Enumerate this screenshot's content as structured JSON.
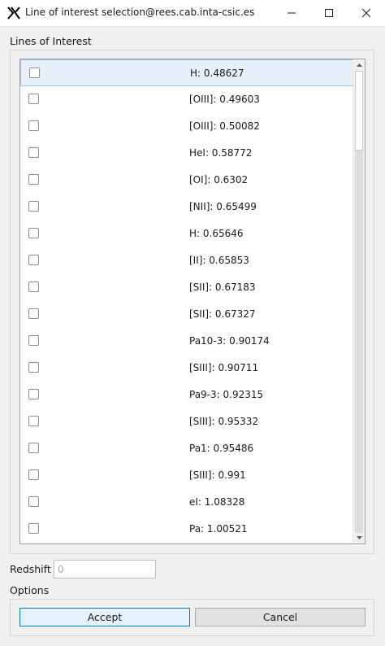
{
  "window": {
    "title": "Line of interest selection@rees.cab.inta-csic.es",
    "app_icon": "x-logo-icon",
    "controls": [
      "minimize-icon",
      "maximize-icon",
      "close-icon"
    ]
  },
  "lines_section": {
    "label": "Lines of Interest",
    "items": [
      {
        "label": "H: 0.48627",
        "checked": false,
        "selected": true
      },
      {
        "label": "[OIII]: 0.49603",
        "checked": false
      },
      {
        "label": "[OIII]: 0.50082",
        "checked": false
      },
      {
        "label": "HeI: 0.58772",
        "checked": false
      },
      {
        "label": "[OI]: 0.6302",
        "checked": false
      },
      {
        "label": "[NII]: 0.65499",
        "checked": false
      },
      {
        "label": "H: 0.65646",
        "checked": false
      },
      {
        "label": "[II]: 0.65853",
        "checked": false
      },
      {
        "label": "[SII]: 0.67183",
        "checked": false
      },
      {
        "label": "[SII]: 0.67327",
        "checked": false
      },
      {
        "label": "Pa10-3: 0.90174",
        "checked": false
      },
      {
        "label": "[SIII]: 0.90711",
        "checked": false
      },
      {
        "label": "Pa9-3: 0.92315",
        "checked": false
      },
      {
        "label": "[SIII]: 0.95332",
        "checked": false
      },
      {
        "label": "Pa1: 0.95486",
        "checked": false
      },
      {
        "label": "[SIII]: 0.991",
        "checked": false
      },
      {
        "label": "eI: 1.08328",
        "checked": false
      },
      {
        "label": "Pa: 1.00521",
        "checked": false
      }
    ]
  },
  "redshift": {
    "label": "Redshift",
    "placeholder": "0",
    "value": ""
  },
  "options": {
    "label": "Options",
    "accept_label": "Accept",
    "cancel_label": "Cancel"
  },
  "colors": {
    "selected_row_bg": "#e5f0fb",
    "selected_row_border": "#99c3e6",
    "accept_border": "#0078d7"
  }
}
